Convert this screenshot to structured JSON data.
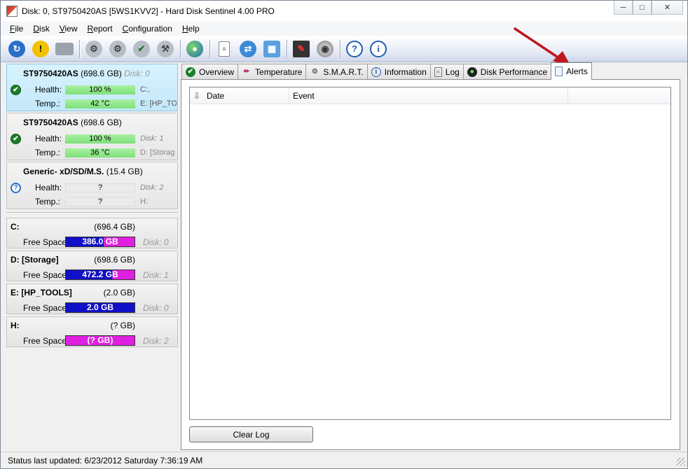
{
  "window": {
    "title": "Disk: 0, ST9750420AS [5WS1KVV2]  -  Hard Disk Sentinel 4.00 PRO",
    "minimize": "─",
    "restore": "□",
    "close": "✕"
  },
  "menu": [
    {
      "accel": "F",
      "rest": "ile"
    },
    {
      "accel": "D",
      "rest": "isk"
    },
    {
      "accel": "V",
      "rest": "iew"
    },
    {
      "accel": "R",
      "rest": "eport"
    },
    {
      "accel": "C",
      "rest": "onfiguration"
    },
    {
      "accel": "H",
      "rest": "elp"
    }
  ],
  "toolbar": {
    "icons": [
      "refresh-icon",
      "warning-icon",
      "disk-icon",
      "disk-test-icon",
      "disk-test-2-icon",
      "disk-check-icon",
      "disk-tools-icon",
      "globe-icon",
      "report-icon",
      "sync-icon",
      "network-icon",
      "monitor-icon",
      "sound-icon",
      "help-icon",
      "info-icon"
    ]
  },
  "disks": [
    {
      "name": "ST9750420AS",
      "size": "(698.6 GB)",
      "disk_no": "Disk: 0",
      "health_label": "Health:",
      "health": "100 %",
      "temp_label": "Temp.:",
      "temp": "42 °C",
      "side1": "C:,",
      "side2": "E: [HP_TO",
      "status": "ok"
    },
    {
      "name": "ST9750420AS",
      "size": "(698.6 GB)",
      "disk_no": "",
      "health_label": "Health:",
      "health": "100 %",
      "temp_label": "Temp.:",
      "temp": "36 °C",
      "side1": "Disk: 1",
      "side2": "D: [Storag",
      "status": "ok"
    },
    {
      "name": "Generic- xD/SD/M.S.",
      "size": "(15.4 GB)",
      "disk_no": "",
      "health_label": "Health:",
      "health": "?",
      "temp_label": "Temp.:",
      "temp": "?",
      "side1": "Disk: 2",
      "side2": "H:",
      "status": "unknown"
    }
  ],
  "partitions": [
    {
      "name": "C:",
      "size": "(696.4 GB)",
      "free_label": "Free Space",
      "free": "386.0 GB",
      "free_fraction": 0.554,
      "disk": "Disk: 0"
    },
    {
      "name": "D: [Storage]",
      "size": "(698.6 GB)",
      "free_label": "Free Space",
      "free": "472.2 GB",
      "free_fraction": 0.676,
      "disk": "Disk: 1"
    },
    {
      "name": "E: [HP_TOOLS]",
      "size": "(2.0 GB)",
      "free_label": "Free Space",
      "free": "2.0 GB",
      "free_fraction": 1.0,
      "disk": "Disk: 0"
    },
    {
      "name": "H:",
      "size": "(? GB)",
      "free_label": "Free Space",
      "free": "(? GB)",
      "free_fraction": 0.0,
      "disk": "Disk: 2"
    }
  ],
  "tabs": [
    {
      "label": "Overview",
      "icon": "check-icon"
    },
    {
      "label": "Temperature",
      "icon": "thermometer-icon"
    },
    {
      "label": "S.M.A.R.T.",
      "icon": "smart-icon"
    },
    {
      "label": "Information",
      "icon": "info-icon"
    },
    {
      "label": "Log",
      "icon": "log-icon"
    },
    {
      "label": "Disk Performance",
      "icon": "performance-icon"
    },
    {
      "label": "Alerts",
      "icon": "alerts-icon",
      "active": true
    }
  ],
  "alerts": {
    "columns": [
      "Date",
      "Event"
    ],
    "rows": [],
    "clear_button": "Clear Log"
  },
  "status": {
    "text": "Status last updated: 6/23/2012 Saturday 7:36:19 AM"
  },
  "colors": {
    "health_green": "#7ee07a",
    "free_blue": "#1010c8",
    "free_magenta": "#e020e0",
    "selected_disk_bg": "#c4e8fa",
    "annotation_arrow": "#c0161e"
  }
}
